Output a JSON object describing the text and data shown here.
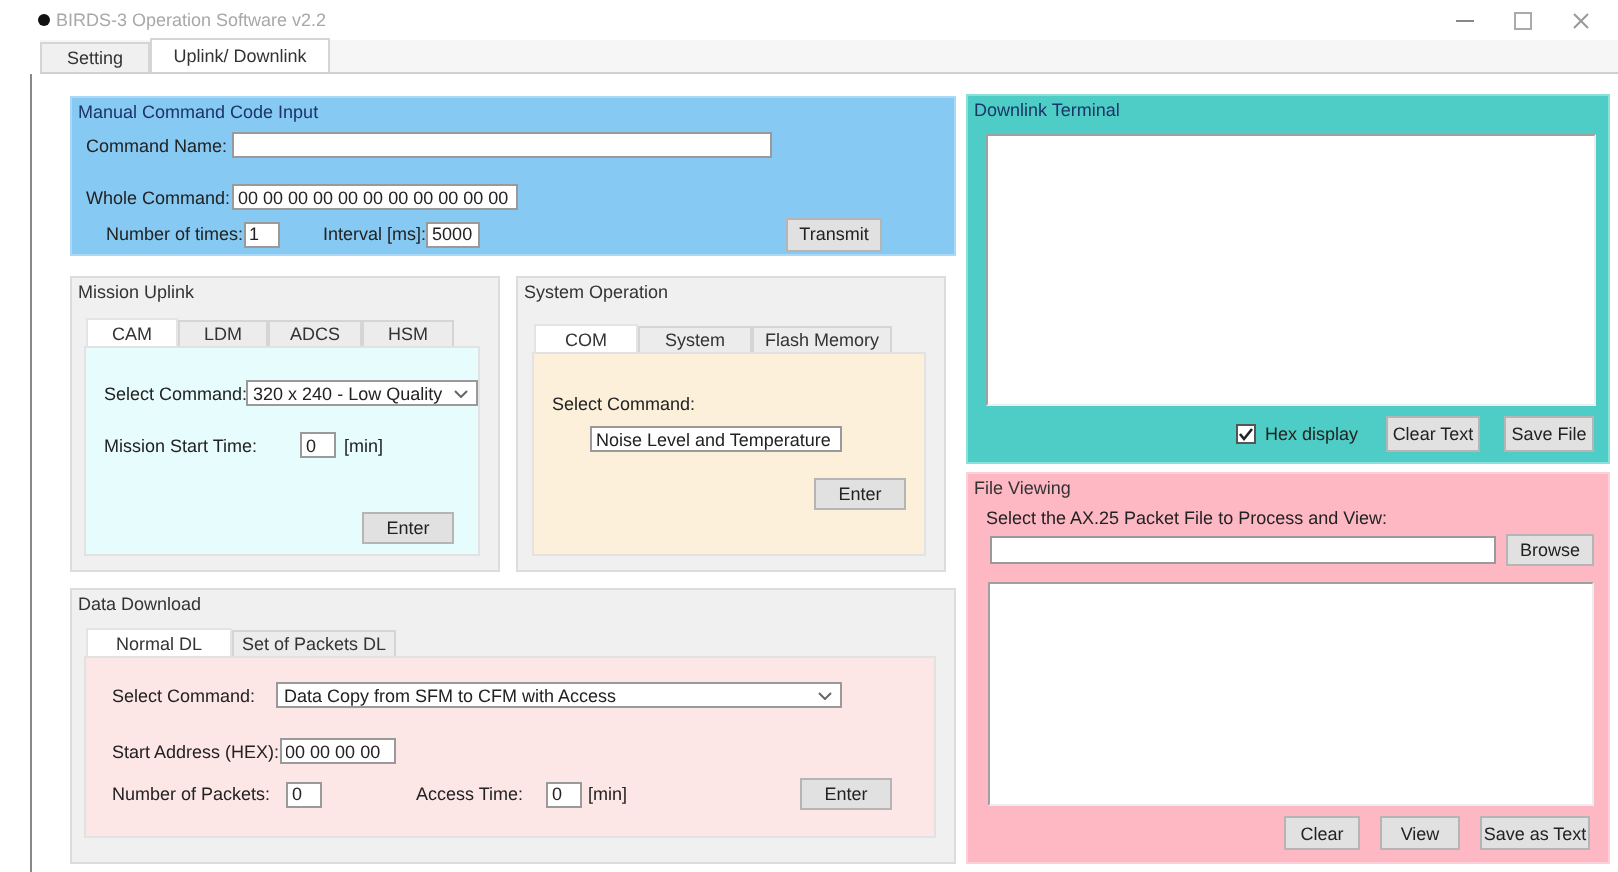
{
  "window": {
    "title": "BIRDS-3 Operation Software v2.2"
  },
  "tabs": [
    {
      "label": "Setting",
      "selected": false
    },
    {
      "label": "Uplink/ Downlink",
      "selected": true
    }
  ],
  "manual_command": {
    "title": "Manual Command Code Input",
    "command_name": {
      "label": "Command Name:"
    },
    "whole_command": {
      "label": "Whole Command:",
      "value": "00 00 00 00 00 00 00 00 00 00 00"
    },
    "number_of_times": {
      "label": "Number of times:",
      "value": "1"
    },
    "interval": {
      "label": "Interval [ms]:",
      "value": "5000"
    },
    "button": "Transmit"
  },
  "mission_uplink": {
    "title": "Mission Uplink",
    "tabs": [
      {
        "label": "CAM",
        "selected": true
      },
      {
        "label": "LDM",
        "selected": false
      },
      {
        "label": "ADCS",
        "selected": false
      },
      {
        "label": "HSM",
        "selected": false
      }
    ],
    "select_command": {
      "label": "Select Command:",
      "value": "320 x 240 - Low Quality"
    },
    "start_time": {
      "label": "Mission Start Time:",
      "value": "0",
      "unit": "[min]"
    },
    "button": "Enter"
  },
  "system_operation": {
    "title": "System Operation",
    "tabs": [
      {
        "label": "COM",
        "selected": true
      },
      {
        "label": "System",
        "selected": false
      },
      {
        "label": "Flash Memory",
        "selected": false
      }
    ],
    "select_command": {
      "label": "Select Command:",
      "value": "Noise Level and Temperature"
    },
    "button": "Enter"
  },
  "data_download": {
    "title": "Data Download",
    "tabs": [
      {
        "label": "Normal DL",
        "selected": true
      },
      {
        "label": "Set of Packets DL",
        "selected": false
      }
    ],
    "select_command": {
      "label": "Select Command:",
      "value": "Data Copy from SFM to CFM with Access"
    },
    "start_address": {
      "label": "Start Address (HEX):",
      "value": "00 00 00 00"
    },
    "packets": {
      "label": "Number of Packets:",
      "value": "0"
    },
    "access_time": {
      "label": "Access Time:",
      "value": "0",
      "unit": "[min]"
    },
    "button": "Enter"
  },
  "downlink_terminal": {
    "title": "Downlink Terminal",
    "hex_display": {
      "label": "Hex display",
      "checked": true
    },
    "buttons": [
      "Clear Text",
      "Save File"
    ]
  },
  "file_viewing": {
    "title": "File Viewing",
    "prompt": "Select the AX.25 Packet File to Process and View:",
    "browse": "Browse",
    "buttons": [
      "Clear",
      "View",
      "Save as Text"
    ]
  }
}
